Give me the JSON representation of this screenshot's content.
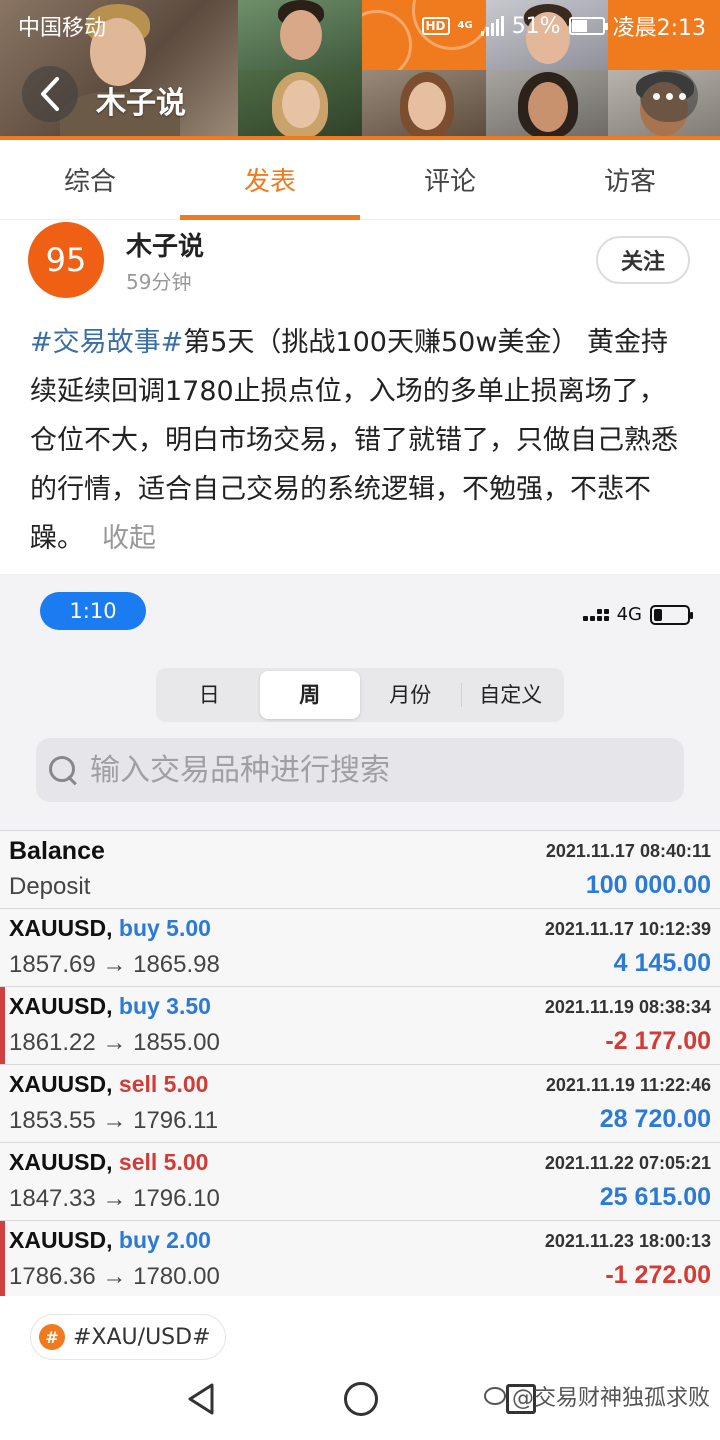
{
  "status_bar": {
    "carrier": "中国移动",
    "hd": "HD",
    "network": "4G",
    "battery": "51%",
    "battery_level": 0.51,
    "time": "凌晨2:13"
  },
  "header": {
    "title": "木子说"
  },
  "tabs": [
    {
      "label": "综合",
      "active": false
    },
    {
      "label": "发表",
      "active": true
    },
    {
      "label": "评论",
      "active": false
    },
    {
      "label": "访客",
      "active": false
    }
  ],
  "post": {
    "avatar_text": "95",
    "author": "木子说",
    "time": "59分钟",
    "follow_label": "关注",
    "hashtag": "#交易故事#",
    "body": "第5天（挑战100天赚50w美金） 黄金持续延续回调1780止损点位，入场的多单止损离场了，仓位不大，明白市场交易，错了就错了，只做自己熟悉的行情，适合自己交易的系统逻辑，不勉强，不悲不躁。",
    "collapse_label": "收起"
  },
  "screenshot": {
    "time": "1:10",
    "network": "4G",
    "battery_level": 0.25,
    "segments": [
      {
        "label": "日",
        "active": false
      },
      {
        "label": "周",
        "active": true
      },
      {
        "label": "月份",
        "active": false
      },
      {
        "label": "自定义",
        "active": false
      }
    ],
    "search_placeholder": "输入交易品种进行搜索",
    "rows": [
      {
        "symbol": "Balance",
        "side": "",
        "side_class": "",
        "detail": "Deposit",
        "date": "2021.11.17 08:40:11",
        "amount": "100 000.00",
        "amount_class": "amt-pos",
        "loss": false
      },
      {
        "symbol": "XAUUSD,",
        "side": "buy 5.00",
        "side_class": "buy",
        "detail": "1857.69 → 1865.98",
        "date": "2021.11.17 10:12:39",
        "amount": "4 145.00",
        "amount_class": "amt-pos",
        "loss": false
      },
      {
        "symbol": "XAUUSD,",
        "side": "buy 3.50",
        "side_class": "buy",
        "detail": "1861.22 → 1855.00",
        "date": "2021.11.19 08:38:34",
        "amount": "-2 177.00",
        "amount_class": "amt-neg",
        "loss": true
      },
      {
        "symbol": "XAUUSD,",
        "side": "sell 5.00",
        "side_class": "sell",
        "detail": "1853.55 → 1796.11",
        "date": "2021.11.19 11:22:46",
        "amount": "28 720.00",
        "amount_class": "amt-pos",
        "loss": false
      },
      {
        "symbol": "XAUUSD,",
        "side": "sell 5.00",
        "side_class": "sell",
        "detail": "1847.33 → 1796.10",
        "date": "2021.11.22 07:05:21",
        "amount": "25 615.00",
        "amount_class": "amt-pos",
        "loss": false
      },
      {
        "symbol": "XAUUSD,",
        "side": "buy 2.00",
        "side_class": "buy",
        "detail": "1786.36 → 1780.00",
        "date": "2021.11.23 18:00:13",
        "amount": "-1 272.00",
        "amount_class": "amt-neg",
        "loss": true
      }
    ]
  },
  "topic": {
    "icon": "#",
    "label": "#XAU/USD#"
  },
  "watermark": "@交易财神独孤求败",
  "colors": {
    "accent": "#f07a1e",
    "avatar": "#f06014",
    "hashtag": "#3a6ea8",
    "buy": "#2a7ad6",
    "sell": "#d23b36",
    "time_pill": "#1a7cf0"
  }
}
